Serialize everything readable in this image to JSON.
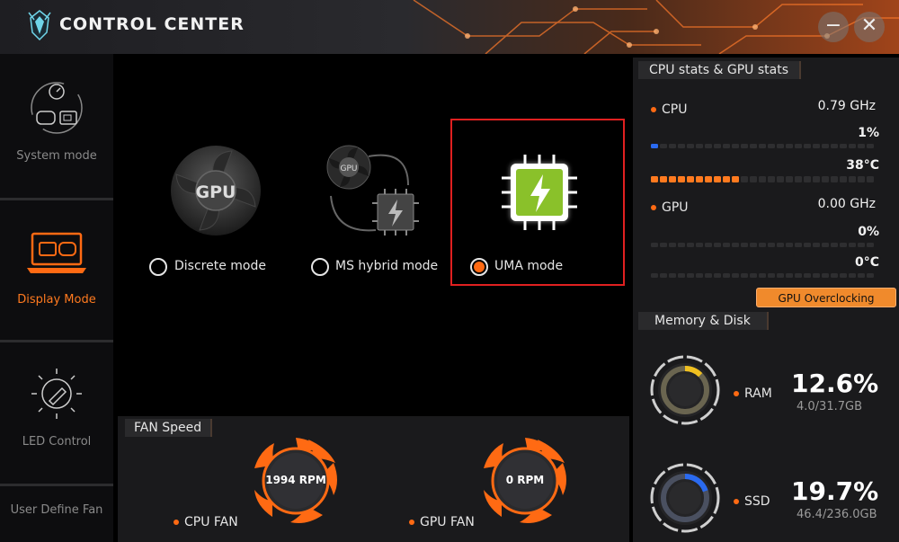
{
  "window": {
    "title": "CONTROL CENTER",
    "minimize_glyph": "−",
    "close_glyph": "✕"
  },
  "sidebar": {
    "items": [
      {
        "label": "System mode",
        "icon": "system-mode-icon",
        "active": false
      },
      {
        "label": "Display Mode",
        "icon": "display-mode-icon",
        "active": true
      },
      {
        "label": "LED Control",
        "icon": "led-control-icon",
        "active": false
      },
      {
        "label": "User Define Fan",
        "icon": "",
        "active": false
      }
    ]
  },
  "display_modes": {
    "discrete": {
      "label": "Discrete mode",
      "icon_text": "GPU",
      "selected": false
    },
    "hybrid": {
      "label": "MS hybrid mode",
      "icon_text": "GPU",
      "selected": false
    },
    "uma": {
      "label": "UMA mode",
      "selected": true
    }
  },
  "fan_speed": {
    "title": "FAN Speed",
    "cpu": {
      "label": "CPU FAN",
      "rpm": "1994 RPM"
    },
    "gpu": {
      "label": "GPU FAN",
      "rpm": "0 RPM"
    }
  },
  "stats": {
    "title": "CPU stats & GPU stats",
    "cpu": {
      "label": "CPU",
      "freq": "0.79 GHz",
      "usage": "1%",
      "usage_fraction": 0.01,
      "temp": "38°C",
      "temp_fraction": 0.38
    },
    "gpu": {
      "label": "GPU",
      "freq": "0.00 GHz",
      "usage": "0%",
      "usage_fraction": 0.0,
      "temp": "0°C",
      "temp_fraction": 0.0
    },
    "overclock_label": "GPU Overclocking"
  },
  "memory": {
    "title": "Memory & Disk",
    "ram": {
      "label": "RAM",
      "percent": "12.6%",
      "detail": "4.0/31.7GB",
      "fraction": 0.126
    },
    "ssd": {
      "label": "SSD",
      "percent": "19.7%",
      "detail": "46.4/236.0GB",
      "fraction": 0.197
    }
  },
  "colors": {
    "accent": "#ff6a13",
    "highlight": "#e02020",
    "uma_chip": "#8ac12a"
  }
}
